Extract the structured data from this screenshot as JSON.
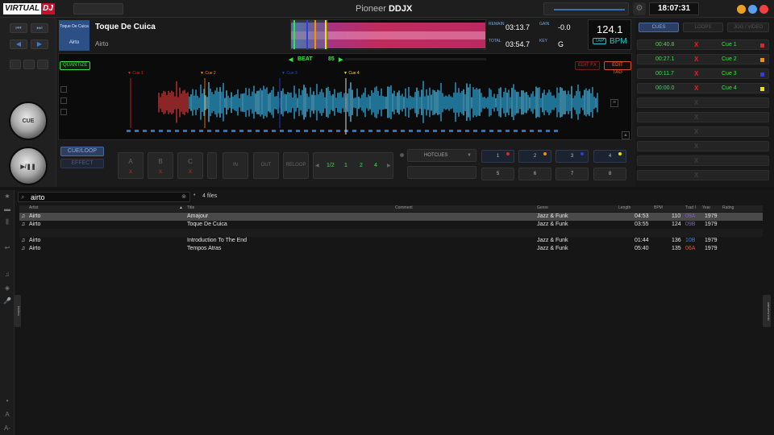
{
  "app": {
    "logo_part1": "VIRTUAL",
    "logo_part2": "DJ",
    "brand_prefix": "Pioneer",
    "brand_model": "DDJX",
    "clock": "18:07:31"
  },
  "track": {
    "title": "Toque De Cuica",
    "artist": "Airto",
    "cover_text": "Airto",
    "cover_top": "Toque De Cuica"
  },
  "info": {
    "remain_label": "REMAIN",
    "remain": "03:13.7",
    "total_label": "TOTAL",
    "total": "03:54.7",
    "gain_label": "GAIN",
    "gain": "-0.0",
    "key_label": "KEY",
    "key": "G",
    "bpm": "124.1",
    "tap": "TAP",
    "bpm_label": "BPM"
  },
  "wave": {
    "quantize": "QUANTIZE",
    "beat": "BEAT",
    "beat_value": "85",
    "edit_fx": "EDIT FX",
    "edit_tag": "EDIT TAG",
    "cue_markers": [
      {
        "label": "Cue 1",
        "color": "#e02525"
      },
      {
        "label": "Cue 2",
        "color": "#ff8c00"
      },
      {
        "label": "Cue 3",
        "color": "#2a3fe0"
      },
      {
        "label": "Cue 4",
        "color": "#f2e000"
      }
    ]
  },
  "pads": {
    "cue_loop": "CUE/LOOP",
    "effect": "EFFECT",
    "a": "A",
    "b": "B",
    "c": "C",
    "x": "X",
    "in": "IN",
    "out": "OUT",
    "reloop": "RELOOP",
    "loops": [
      "1/2",
      "1",
      "2",
      "4"
    ],
    "hotcues_label": "HOTCUES",
    "hotcues": [
      "1",
      "2",
      "3",
      "4",
      "5",
      "6",
      "7",
      "8"
    ]
  },
  "cuelist": {
    "tabs": [
      "CUES",
      "LOOPS",
      "JOG / VIDEO"
    ],
    "rows": [
      {
        "time": "00:40.8",
        "name": "Cue 1",
        "color": "#e02525"
      },
      {
        "time": "00:27.1",
        "name": "Cue 2",
        "color": "#ff8c00"
      },
      {
        "time": "00:11.7",
        "name": "Cue 3",
        "color": "#2a3fe0"
      },
      {
        "time": "00:00.0",
        "name": "Cue 4",
        "color": "#f2e000"
      }
    ],
    "x": "X"
  },
  "browser": {
    "search": "airto",
    "files": "4 files",
    "columns": [
      "Artist",
      "Title",
      "Comment",
      "Genre",
      "Length",
      "BPM",
      "Trad I",
      "Year",
      "Rating"
    ],
    "rows": [
      {
        "artist": "Airto",
        "title": "Amajour",
        "comment": "",
        "genre": "Jazz & Funk",
        "length": "04:53",
        "bpm": "110",
        "key": "09A",
        "year": "1979",
        "key_color": "#7a62c8"
      },
      {
        "artist": "Airto",
        "title": "Toque De Cuica",
        "comment": "",
        "genre": "Jazz & Funk",
        "length": "03:55",
        "bpm": "124",
        "key": "09B",
        "year": "1979",
        "key_color": "#7a62c8"
      },
      {
        "artist": "Airto",
        "title": "Introduction To The End",
        "comment": "",
        "genre": "Jazz & Funk",
        "length": "01:44",
        "bpm": "136",
        "key": "10B",
        "year": "1979",
        "key_color": "#4a78e0"
      },
      {
        "artist": "Airto",
        "title": "Tempos Atras",
        "comment": "",
        "genre": "Jazz & Funk",
        "length": "05:40",
        "bpm": "135",
        "key": "06A",
        "year": "1979",
        "key_color": "#e05545"
      }
    ],
    "folders_tab": "folders",
    "sideview_tab": "sideview info"
  },
  "colors": {
    "accent": "#28c8c8",
    "green": "#3be04a",
    "red": "#e02525",
    "wave": "#2fb8f0"
  }
}
